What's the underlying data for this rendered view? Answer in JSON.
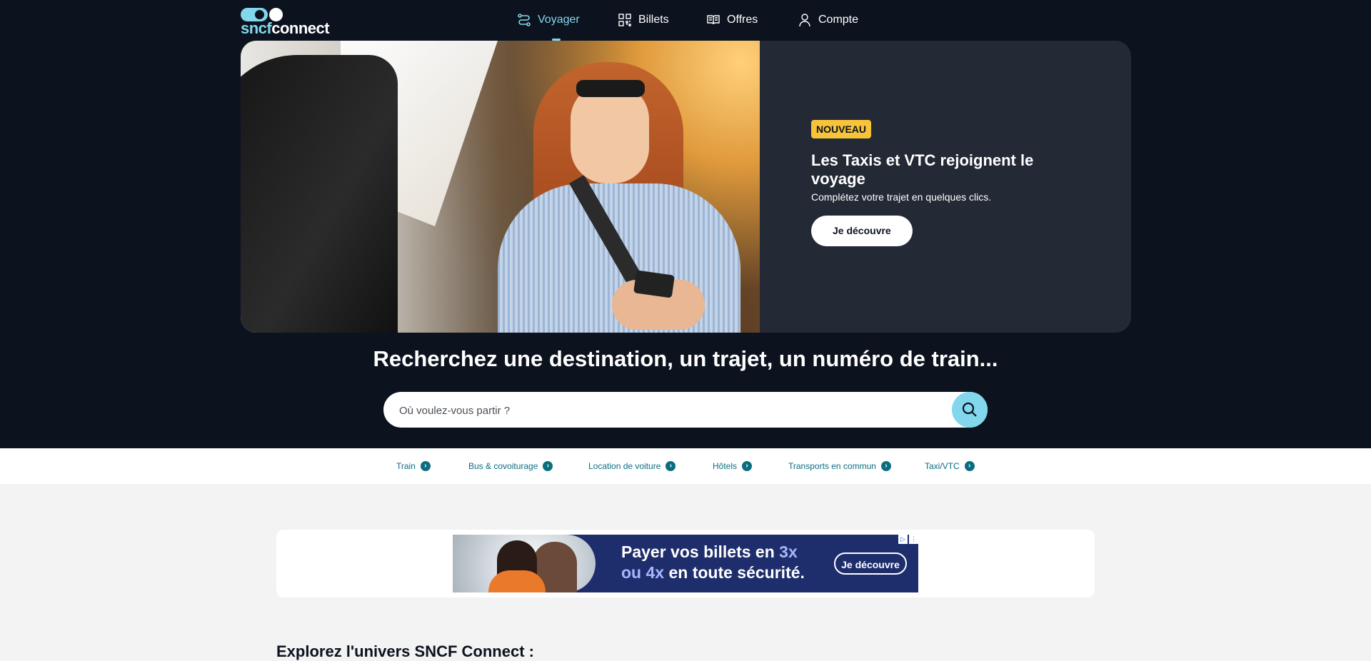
{
  "header": {
    "logo_part1": "sncf",
    "logo_part2": "connect",
    "nav": [
      {
        "label": "Voyager",
        "icon": "route-icon",
        "active": true
      },
      {
        "label": "Billets",
        "icon": "qr-code-icon",
        "active": false
      },
      {
        "label": "Offres",
        "icon": "book-icon",
        "active": false
      },
      {
        "label": "Compte",
        "icon": "user-icon",
        "active": false
      }
    ]
  },
  "hero": {
    "badge": "NOUVEAU",
    "title": "Les Taxis et VTC rejoignent le voyage",
    "subtitle": "Complétez votre trajet en quelques clics.",
    "cta": "Je découvre"
  },
  "search": {
    "heading": "Recherchez une destination, un trajet, un numéro de train...",
    "placeholder": "Où voulez-vous partir ?"
  },
  "categories": [
    {
      "label": "Train"
    },
    {
      "label": "Bus & covoiturage"
    },
    {
      "label": "Location de voiture"
    },
    {
      "label": "Hôtels"
    },
    {
      "label": "Transports en commun"
    },
    {
      "label": "Taxi/VTC"
    }
  ],
  "ad": {
    "line1_prefix": "Payer vos billets en ",
    "line1_highlight": "3x",
    "line2_highlight": "ou 4x",
    "line2_suffix": " en toute sécurité.",
    "cta": "Je découvre"
  },
  "explore_title": "Explorez l'univers SNCF Connect :",
  "colors": {
    "navy": "#0c131f",
    "accent": "#82d7ed",
    "badge": "#f7c338",
    "link": "#0a6e80"
  }
}
